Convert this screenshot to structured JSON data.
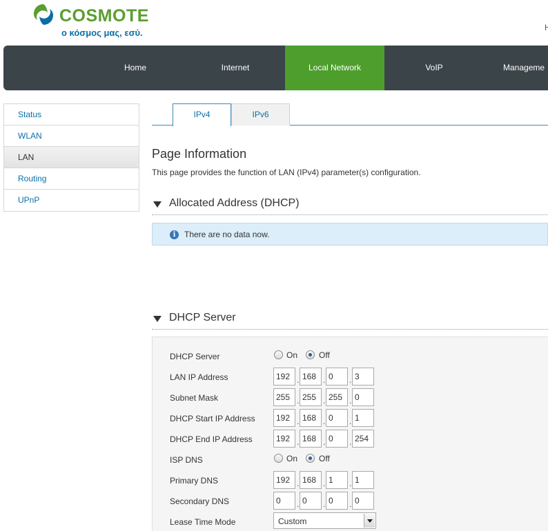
{
  "header": {
    "brand": "COSMOTE",
    "slogan": "ο κόσμος μας, εσύ.",
    "top_link": "H"
  },
  "colors": {
    "brand_green": "#5a9e2f",
    "brand_blue": "#0b6ea8",
    "nav_bg": "#3b4449",
    "nav_active": "#4e9e2d"
  },
  "nav": {
    "items": [
      {
        "label": "Home"
      },
      {
        "label": "Internet"
      },
      {
        "label": "Local Network",
        "active": true
      },
      {
        "label": "VoIP"
      },
      {
        "label": "Manageme"
      }
    ]
  },
  "sidebar": {
    "items": [
      {
        "label": "Status"
      },
      {
        "label": "WLAN"
      },
      {
        "label": "LAN",
        "active": true
      },
      {
        "label": "Routing"
      },
      {
        "label": "UPnP"
      }
    ]
  },
  "tabs": [
    {
      "label": "IPv4",
      "active": true
    },
    {
      "label": "IPv6"
    }
  ],
  "page": {
    "title": "Page Information",
    "description": "This page provides the function of LAN (IPv4) parameter(s) configuration."
  },
  "allocated": {
    "heading": "Allocated Address (DHCP)",
    "empty_message": "There are no data now.",
    "info_icon": "info-icon"
  },
  "dhcp": {
    "heading": "DHCP Server",
    "server": {
      "label": "DHCP Server",
      "on_label": "On",
      "off_label": "Off",
      "selected": "Off"
    },
    "lan_ip": {
      "label": "LAN IP Address",
      "octets": [
        "192",
        "168",
        "0",
        "3"
      ]
    },
    "subnet": {
      "label": "Subnet Mask",
      "octets": [
        "255",
        "255",
        "255",
        "0"
      ]
    },
    "start_ip": {
      "label": "DHCP Start IP Address",
      "octets": [
        "192",
        "168",
        "0",
        "1"
      ]
    },
    "end_ip": {
      "label": "DHCP End IP Address",
      "octets": [
        "192",
        "168",
        "0",
        "254"
      ]
    },
    "isp_dns": {
      "label": "ISP DNS",
      "on_label": "On",
      "off_label": "Off",
      "selected": "Off"
    },
    "primary_dns": {
      "label": "Primary DNS",
      "octets": [
        "192",
        "168",
        "1",
        "1"
      ]
    },
    "secondary_dns": {
      "label": "Secondary DNS",
      "octets": [
        "0",
        "0",
        "0",
        "0"
      ]
    },
    "lease_mode": {
      "label": "Lease Time Mode",
      "value": "Custom"
    }
  }
}
